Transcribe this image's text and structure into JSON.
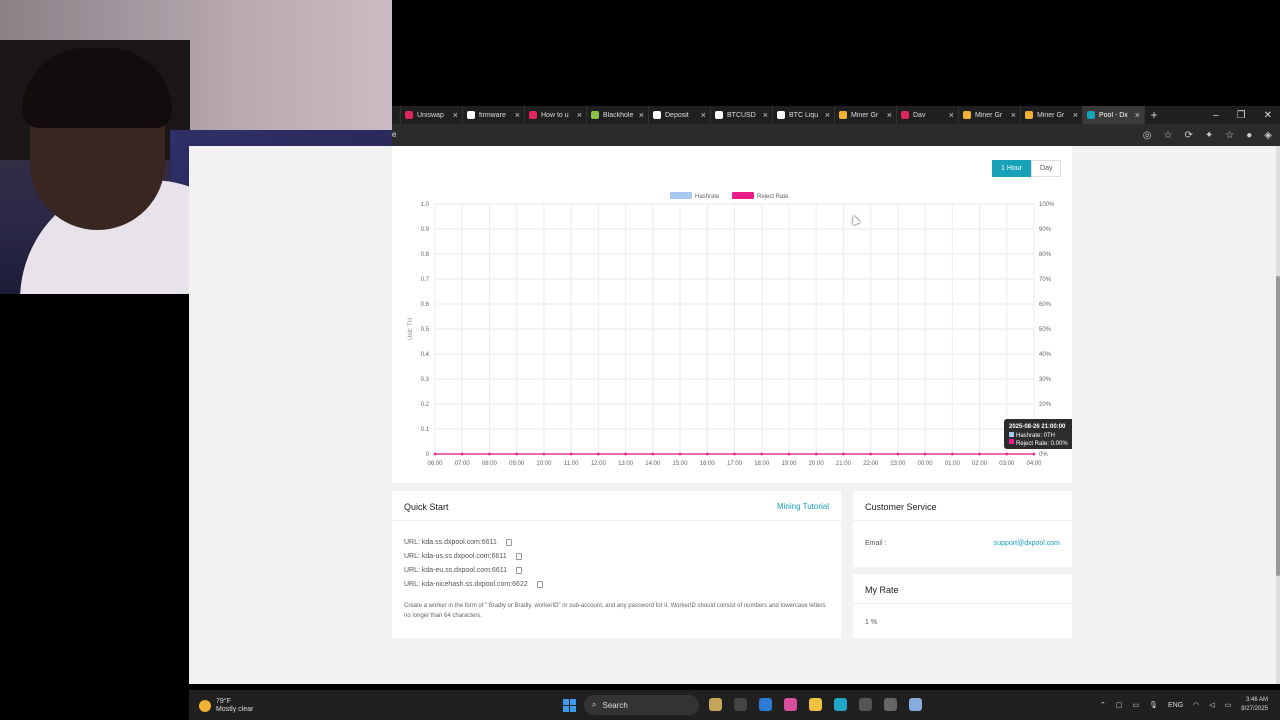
{
  "browser": {
    "tabs": [
      {
        "label": "",
        "color": "#888"
      },
      {
        "label": "Uniswap",
        "color": "#e0245e"
      },
      {
        "label": "firmware",
        "color": "#ffffff"
      },
      {
        "label": "How to u",
        "color": "#e0245e"
      },
      {
        "label": "Blackhole",
        "color": "#8bc34a"
      },
      {
        "label": "Deposit",
        "color": "#ffffff"
      },
      {
        "label": "BTCUSD",
        "color": "#ffffff"
      },
      {
        "label": "BTC Liqu",
        "color": "#ffffff"
      },
      {
        "label": "Miner Gr",
        "color": "#f2b233"
      },
      {
        "label": "Dav",
        "color": "#e0245e"
      },
      {
        "label": "Miner Gr",
        "color": "#f2b233"
      },
      {
        "label": "Miner Gr",
        "color": "#f2b233"
      },
      {
        "label": "Pool - Dx",
        "color": "#17a2b8",
        "active": true
      }
    ],
    "address_prefix": "e"
  },
  "chart": {
    "toggle": {
      "hour": "1 Hour",
      "day": "Day"
    },
    "tooltip": {
      "time": "2025-08-26 21:00:00",
      "hashrate": "Hashrate:  0TH",
      "reject": "Reject Rate:  0.00%"
    }
  },
  "chart_data": {
    "type": "line",
    "title": "",
    "xlabel": "",
    "ylabel": "Unit: TH",
    "x": [
      "06:00",
      "07:00",
      "08:00",
      "09:00",
      "10:00",
      "11:00",
      "12:00",
      "13:00",
      "14:00",
      "15:00",
      "16:00",
      "17:00",
      "18:00",
      "19:00",
      "20:00",
      "21:00",
      "22:00",
      "23:00",
      "00:00",
      "01:00",
      "02:00",
      "03:00",
      "04:00"
    ],
    "series": [
      {
        "name": "Hashrate",
        "color": "#a8c8f0",
        "values": [
          0,
          0,
          0,
          0,
          0,
          0,
          0,
          0,
          0,
          0,
          0,
          0,
          0,
          0,
          0,
          0,
          0,
          0,
          0,
          0,
          0,
          0,
          0
        ]
      },
      {
        "name": "Reject Rate",
        "color": "#e91e8c",
        "values": [
          0,
          0,
          0,
          0,
          0,
          0,
          0,
          0,
          0,
          0,
          0,
          0,
          0,
          0,
          0,
          0,
          0,
          0,
          0,
          0,
          0,
          0,
          0
        ]
      }
    ],
    "ylim": [
      0,
      1.0
    ],
    "y_ticks": [
      "0",
      "0.1",
      "0.2",
      "0.3",
      "0.4",
      "0.5",
      "0.6",
      "0.7",
      "0.8",
      "0.9",
      "1.0"
    ],
    "y2_ticks": [
      "0%",
      "10%",
      "20%",
      "30%",
      "40%",
      "50%",
      "60%",
      "70%",
      "80%",
      "90%",
      "100%"
    ],
    "legend": "top-center",
    "grid": true
  },
  "quickstart": {
    "title": "Quick Start",
    "tutorial": "Mining Tutorial",
    "urls": [
      "URL:  kda.ss.dxpool.com:6611",
      "URL:  kda-us.ss.dxpool.com:6611",
      "URL:  kda-eu.ss.dxpool.com:6611",
      "URL:  kda-nicehash.ss.dxpool.com:6622"
    ],
    "note": "Create a worker in the form of \" Bradly or Bradly. workerID\" or sub-account, and any password for it. WorkerID should consist of numbers and lowercase letters no longer than 64 characters."
  },
  "customer_service": {
    "title": "Customer Service",
    "email_label": "Email :",
    "email": "support@dxpool.com"
  },
  "my_rate": {
    "title": "My Rate",
    "value": "1 %"
  },
  "taskbar": {
    "temp": "79°F",
    "weather": "Mostly clear",
    "search": "Search",
    "lang": "ENG",
    "time": "3:46 AM",
    "date": "8/27/2025"
  }
}
